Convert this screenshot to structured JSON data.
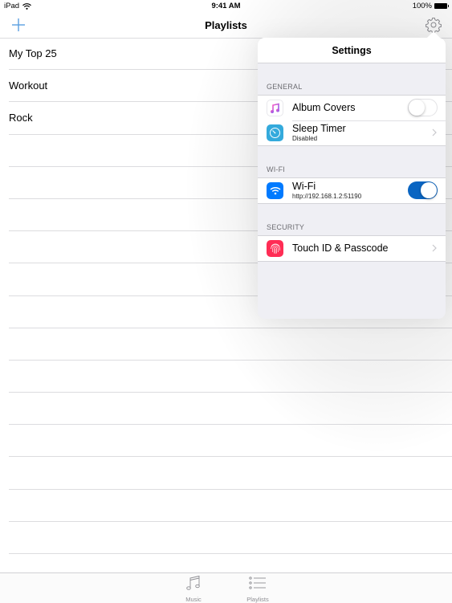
{
  "status_bar": {
    "device": "iPad",
    "time": "9:41 AM",
    "battery": "100%"
  },
  "nav_bar": {
    "title": "Playlists",
    "add_icon": "plus-icon",
    "settings_icon": "gear-icon"
  },
  "playlists": [
    {
      "name": "My Top 25"
    },
    {
      "name": "Workout"
    },
    {
      "name": "Rock"
    }
  ],
  "empty_rows": 14,
  "tab_bar": {
    "tabs": [
      {
        "label": "Music",
        "icon": "music-note-icon",
        "selected": false
      },
      {
        "label": "Playlists",
        "icon": "list-icon",
        "selected": true
      }
    ]
  },
  "settings": {
    "title": "Settings",
    "sections": [
      {
        "header": "GENERAL",
        "items": [
          {
            "title": "Album Covers",
            "icon": "music-app-icon",
            "accessory": "toggle",
            "enabled": false
          },
          {
            "title": "Sleep Timer",
            "subtitle": "Disabled",
            "icon": "timer-icon",
            "accessory": "chevron"
          }
        ]
      },
      {
        "header": "WI-FI",
        "items": [
          {
            "title": "Wi-Fi",
            "subtitle": "http://192.168.1.2:51190",
            "icon": "wifi-icon",
            "accessory": "toggle",
            "enabled": true
          }
        ]
      },
      {
        "header": "SECURITY",
        "items": [
          {
            "title": "Touch ID & Passcode",
            "icon": "fingerprint-icon",
            "accessory": "chevron"
          }
        ]
      }
    ]
  },
  "colors": {
    "tint": "#007aff",
    "toggle_on": "#0a65c2",
    "timer_icon_bg": "#34aadc",
    "wifi_icon_bg": "#007aff",
    "fingerprint_icon_bg": "#ff2d55",
    "grouped_bg": "#efeff4"
  }
}
